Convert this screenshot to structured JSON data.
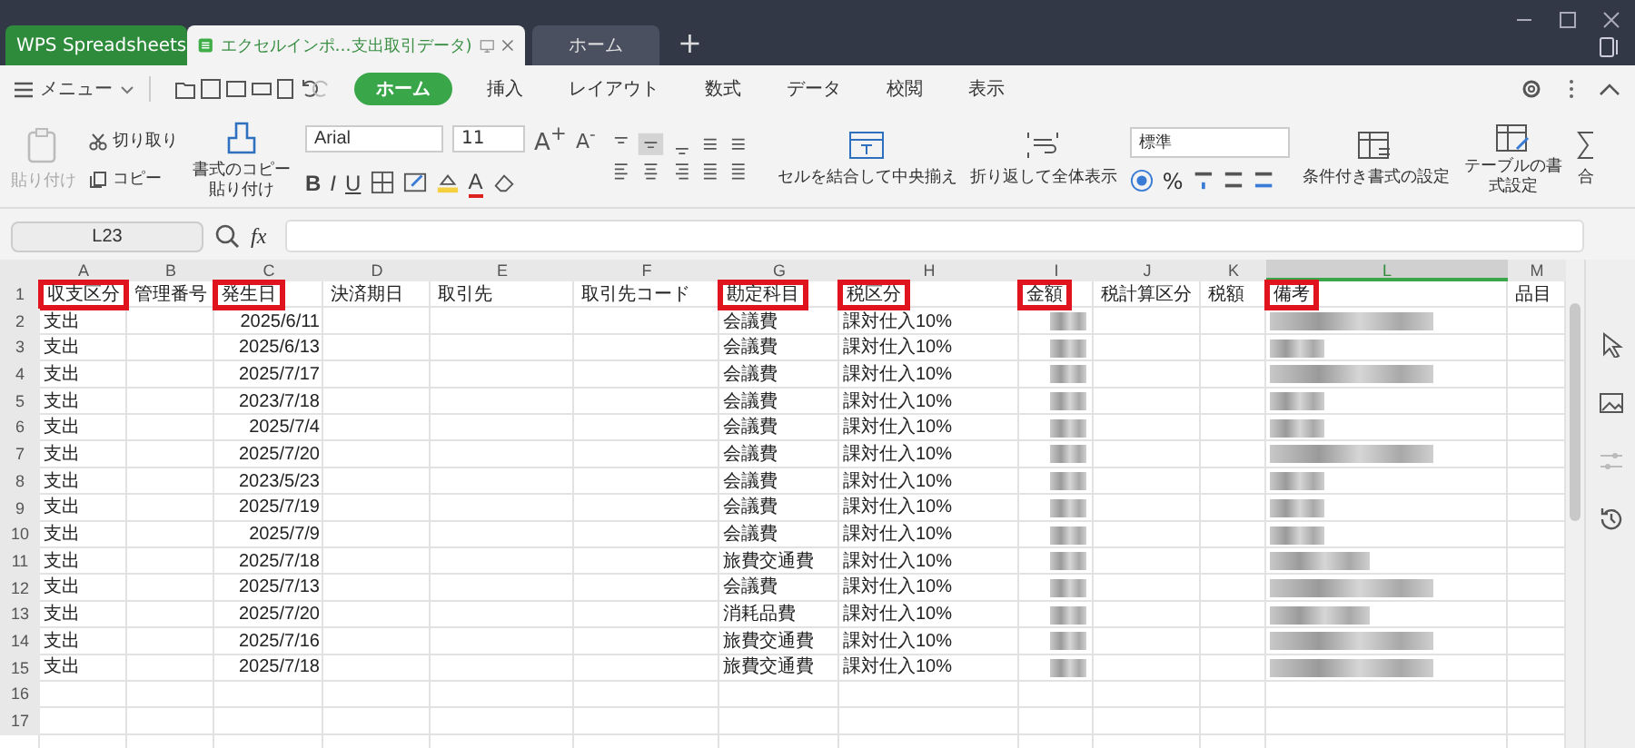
{
  "title_bar": {
    "tabs": [
      {
        "label": "WPS Spreadsheets",
        "kind": "app",
        "selected": false
      },
      {
        "label": "エクセルインポ…支出取引データ)",
        "kind": "document",
        "selected": true
      },
      {
        "label": "ホーム",
        "kind": "home",
        "selected": false
      }
    ],
    "new_tab": "+"
  },
  "menu_bar": {
    "menu": "メニュー",
    "tabs": [
      {
        "label": "ホーム",
        "selected": true
      },
      {
        "label": "挿入",
        "selected": false
      },
      {
        "label": "レイアウト",
        "selected": false
      },
      {
        "label": "数式",
        "selected": false
      },
      {
        "label": "データ",
        "selected": false
      },
      {
        "label": "校閲",
        "selected": false
      },
      {
        "label": "表示",
        "selected": false
      }
    ]
  },
  "ribbon": {
    "paste": "貼り付け",
    "cut": "切り取り",
    "copy": "コピー",
    "format_painter": "書式のコピー貼り付け",
    "font": "Arial",
    "font_size": "11",
    "font_grow": "A$^{+}$",
    "font_shrink": "A$^{-}$",
    "bold": "B",
    "italic": "I",
    "underline": "U",
    "font_color": "A",
    "merge": "セルを結合して中央揃え",
    "wrap": "折り返して全体表示",
    "number_format": "標準",
    "percent": "%",
    "conditional": "条件付き書式の設定",
    "table_format": "テーブルの書式設定",
    "sum": "合"
  },
  "formula_bar": {
    "cell_ref": "L23",
    "fx": "fx"
  },
  "sheet": {
    "columns": [
      {
        "letter": "A",
        "header": "収支区分",
        "highlighted": true,
        "selected": false
      },
      {
        "letter": "B",
        "header": "管理番号",
        "highlighted": false,
        "selected": false
      },
      {
        "letter": "C",
        "header": "発生日",
        "highlighted": true,
        "selected": false
      },
      {
        "letter": "D",
        "header": "決済期日",
        "highlighted": false,
        "selected": false
      },
      {
        "letter": "E",
        "header": "取引先",
        "highlighted": false,
        "selected": false
      },
      {
        "letter": "F",
        "header": "取引先コード",
        "highlighted": false,
        "selected": false
      },
      {
        "letter": "G",
        "header": "勘定科目",
        "highlighted": true,
        "selected": false
      },
      {
        "letter": "H",
        "header": "税区分",
        "highlighted": true,
        "selected": false
      },
      {
        "letter": "I",
        "header": "金額",
        "highlighted": true,
        "selected": false
      },
      {
        "letter": "J",
        "header": "税計算区分",
        "highlighted": false,
        "selected": false
      },
      {
        "letter": "K",
        "header": "税額",
        "highlighted": false,
        "selected": false
      },
      {
        "letter": "L",
        "header": "備考",
        "highlighted": true,
        "selected": true
      },
      {
        "letter": "M",
        "header": "品目",
        "highlighted": false,
        "selected": false
      }
    ],
    "header_row_number": "1",
    "rows": [
      {
        "number": "2",
        "type": "支出",
        "date": "2025/6/11",
        "account": "会議費",
        "tax": "課対仕入10%",
        "note": {
          "kind": "long"
        }
      },
      {
        "number": "3",
        "type": "支出",
        "date": "2025/6/13",
        "account": "会議費",
        "tax": "課対仕入10%",
        "note": {
          "kind": "short"
        }
      },
      {
        "number": "4",
        "type": "支出",
        "date": "2025/7/17",
        "account": "会議費",
        "tax": "課対仕入10%",
        "note": {
          "kind": "long"
        }
      },
      {
        "number": "5",
        "type": "支出",
        "date": "2023/7/18",
        "account": "会議費",
        "tax": "課対仕入10%",
        "note": {
          "kind": "short"
        }
      },
      {
        "number": "6",
        "type": "支出",
        "date": "2025/7/4",
        "account": "会議費",
        "tax": "課対仕入10%",
        "note": {
          "kind": "short"
        }
      },
      {
        "number": "7",
        "type": "支出",
        "date": "2025/7/20",
        "account": "会議費",
        "tax": "課対仕入10%",
        "note": {
          "kind": "long"
        }
      },
      {
        "number": "8",
        "type": "支出",
        "date": "2023/5/23",
        "account": "会議費",
        "tax": "課対仕入10%",
        "note": {
          "kind": "short"
        }
      },
      {
        "number": "9",
        "type": "支出",
        "date": "2025/7/19",
        "account": "会議費",
        "tax": "課対仕入10%",
        "note": {
          "kind": "short"
        }
      },
      {
        "number": "10",
        "type": "支出",
        "date": "2025/7/9",
        "account": "会議費",
        "tax": "課対仕入10%",
        "note": {
          "kind": "short"
        }
      },
      {
        "number": "11",
        "type": "支出",
        "date": "2025/7/18",
        "account": "旅費交通費",
        "tax": "課対仕入10%",
        "note": {
          "kind": "medium"
        }
      },
      {
        "number": "12",
        "type": "支出",
        "date": "2025/7/13",
        "account": "会議費",
        "tax": "課対仕入10%",
        "note": {
          "kind": "long"
        }
      },
      {
        "number": "13",
        "type": "支出",
        "date": "2025/7/20",
        "account": "消耗品費",
        "tax": "課対仕入10%",
        "note": {
          "kind": "medium"
        }
      },
      {
        "number": "14",
        "type": "支出",
        "date": "2025/7/16",
        "account": "旅費交通費",
        "tax": "課対仕入10%",
        "note": {
          "kind": "long"
        }
      },
      {
        "number": "15",
        "type": "支出",
        "date": "2025/7/18",
        "account": "旅費交通費",
        "tax": "課対仕入10%",
        "note": {
          "kind": "long"
        }
      }
    ],
    "empty_rows": [
      "16",
      "17"
    ]
  }
}
